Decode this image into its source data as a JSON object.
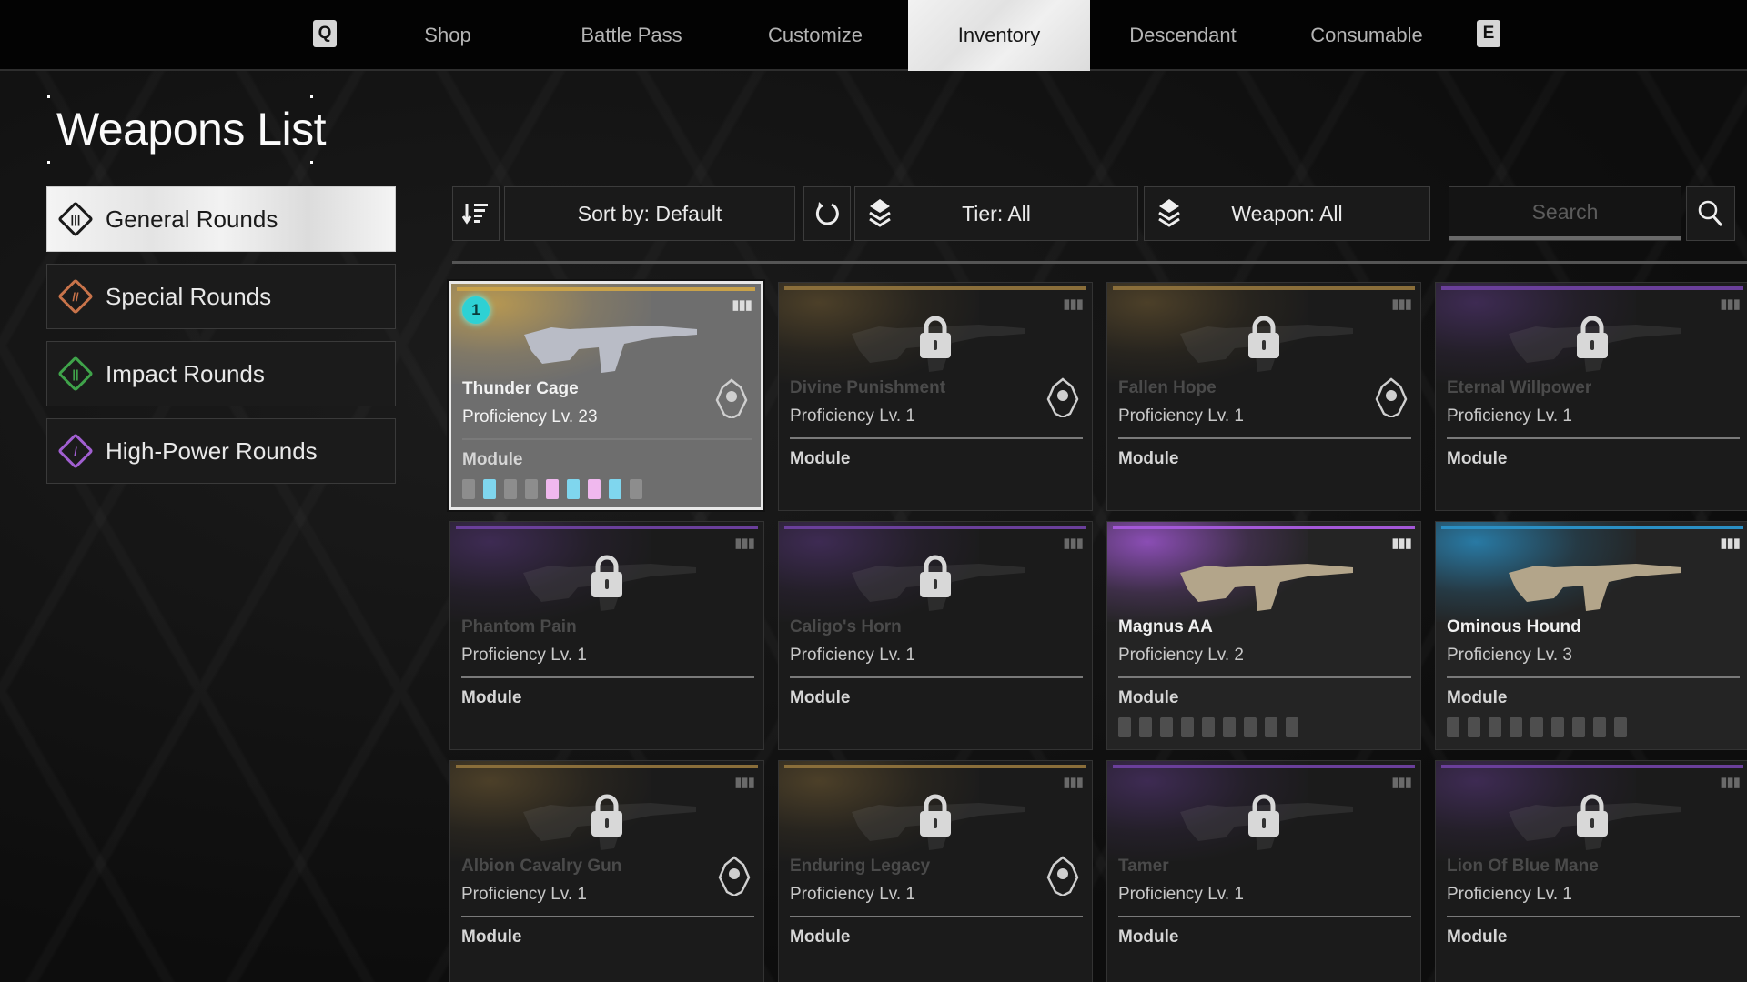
{
  "nav": {
    "prev_key": "Q",
    "next_key": "E",
    "tabs": [
      {
        "label": "Shop",
        "active": false
      },
      {
        "label": "Battle Pass",
        "active": false
      },
      {
        "label": "Customize",
        "active": false
      },
      {
        "label": "Inventory",
        "active": true
      },
      {
        "label": "Descendant",
        "active": false
      },
      {
        "label": "Consumable",
        "active": false
      }
    ]
  },
  "page_title": "Weapons List",
  "sidebar": {
    "items": [
      {
        "label": "General Rounds",
        "icon": "general-rounds-icon",
        "color": "#1a1a1a",
        "active": true
      },
      {
        "label": "Special Rounds",
        "icon": "special-rounds-icon",
        "color": "#c8734a",
        "active": false
      },
      {
        "label": "Impact Rounds",
        "icon": "impact-rounds-icon",
        "color": "#3fa34a",
        "active": false
      },
      {
        "label": "High-Power Rounds",
        "icon": "high-power-rounds-icon",
        "color": "#a15fd1",
        "active": false
      }
    ]
  },
  "filters": {
    "sort_label": "Sort by: Default",
    "tier_label": "Tier: All",
    "weapon_label": "Weapon: All",
    "search_placeholder": "Search",
    "search_value": ""
  },
  "weapons": [
    {
      "name": "Thunder Cage",
      "proficiency": "Proficiency Lv. 23",
      "module_label": "Module",
      "locked": false,
      "selected": true,
      "tier_color": "#c9a24a",
      "badge": "1",
      "emblem": "skull-emblem-icon",
      "slots": [
        "empty",
        "blue",
        "empty",
        "empty",
        "pink",
        "blue",
        "pink",
        "blue",
        "empty"
      ]
    },
    {
      "name": "Divine Punishment",
      "proficiency": "Proficiency Lv. 1",
      "module_label": "Module",
      "locked": true,
      "selected": false,
      "tier_color": "#8a6e3a",
      "emblem": "sunburst-emblem-icon",
      "slots": []
    },
    {
      "name": "Fallen Hope",
      "proficiency": "Proficiency Lv. 1",
      "module_label": "Module",
      "locked": true,
      "selected": false,
      "tier_color": "#8a6e3a",
      "emblem": "mask-emblem-icon",
      "slots": []
    },
    {
      "name": "Eternal Willpower",
      "proficiency": "Proficiency Lv. 1",
      "module_label": "Module",
      "locked": true,
      "selected": false,
      "tier_color": "#6a3f9a",
      "slots": []
    },
    {
      "name": "Phantom Pain",
      "proficiency": "Proficiency Lv. 1",
      "module_label": "Module",
      "locked": true,
      "selected": false,
      "tier_color": "#6a3f9a",
      "slots": []
    },
    {
      "name": "Caligo's Horn",
      "proficiency": "Proficiency Lv. 1",
      "module_label": "Module",
      "locked": true,
      "selected": false,
      "tier_color": "#6a3f9a",
      "slots": []
    },
    {
      "name": "Magnus AA",
      "proficiency": "Proficiency Lv. 2",
      "module_label": "Module",
      "locked": false,
      "selected": false,
      "tier_color": "#a458d8",
      "slots": [
        "empty",
        "empty",
        "empty",
        "empty",
        "empty",
        "empty",
        "empty",
        "empty",
        "empty"
      ]
    },
    {
      "name": "Ominous Hound",
      "proficiency": "Proficiency Lv. 3",
      "module_label": "Module",
      "locked": false,
      "selected": false,
      "tier_color": "#2a8fc4",
      "slots": [
        "empty",
        "empty",
        "empty",
        "empty",
        "empty",
        "empty",
        "empty",
        "empty",
        "empty"
      ]
    },
    {
      "name": "Albion Cavalry Gun",
      "proficiency": "Proficiency Lv. 1",
      "module_label": "Module",
      "locked": true,
      "selected": false,
      "tier_color": "#8a6e3a",
      "emblem": "tower-emblem-icon",
      "slots": []
    },
    {
      "name": "Enduring Legacy",
      "proficiency": "Proficiency Lv. 1",
      "module_label": "Module",
      "locked": true,
      "selected": false,
      "tier_color": "#8a6e3a",
      "emblem": "wreath-emblem-icon",
      "slots": []
    },
    {
      "name": "Tamer",
      "proficiency": "Proficiency Lv. 1",
      "module_label": "Module",
      "locked": true,
      "selected": false,
      "tier_color": "#6a3f9a",
      "slots": []
    },
    {
      "name": "Lion Of Blue Mane",
      "proficiency": "Proficiency Lv. 1",
      "module_label": "Module",
      "locked": true,
      "selected": false,
      "tier_color": "#6a3f9a",
      "slots": []
    }
  ],
  "colors": {
    "slot_blue": "#7fd6ee",
    "slot_pink": "#f0b8ee",
    "slot_empty": "#8d8d8d"
  }
}
